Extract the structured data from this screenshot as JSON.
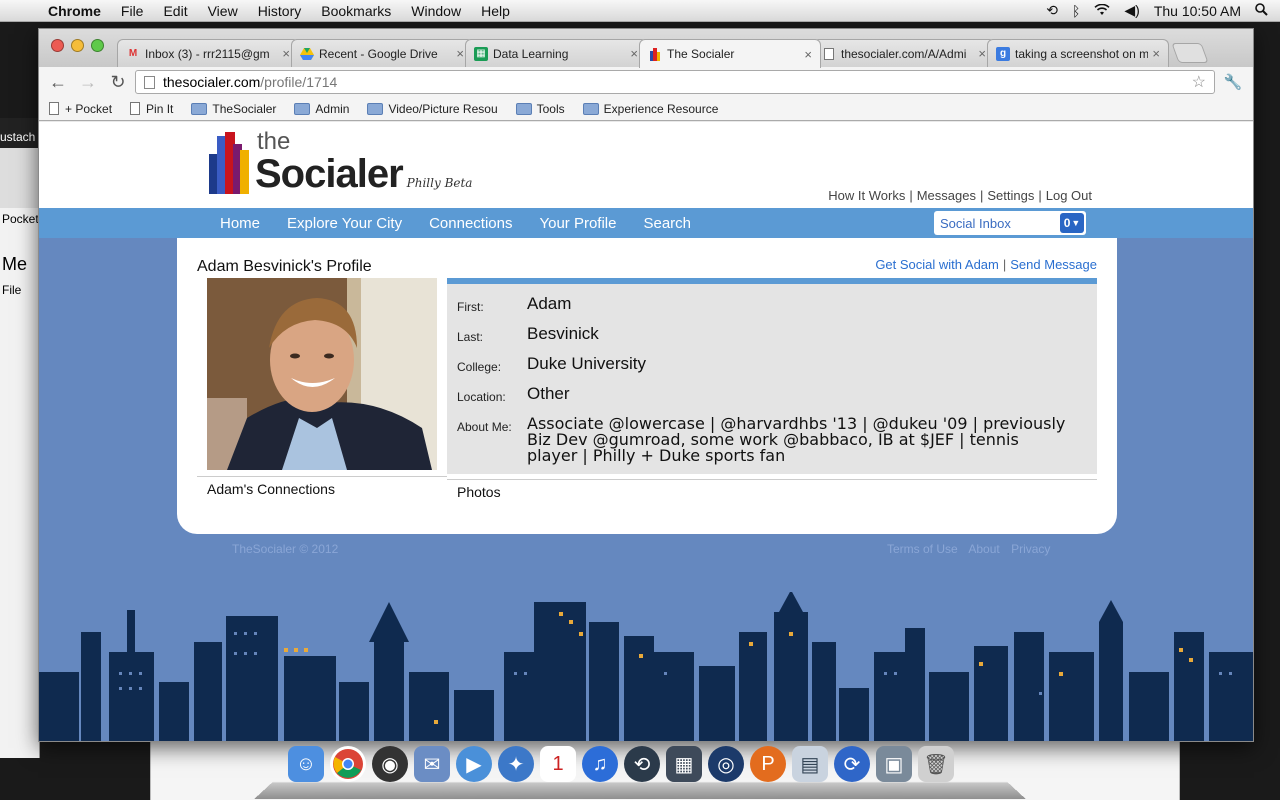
{
  "menubar": {
    "app": "Chrome",
    "menus": [
      "File",
      "Edit",
      "View",
      "History",
      "Bookmarks",
      "Window",
      "Help"
    ],
    "clock": "Thu 10:50 AM"
  },
  "background_window": {
    "title_fragment": "ustach",
    "pocket": "Pocket",
    "heading_fragment": "Me",
    "file": "File"
  },
  "tabs": [
    {
      "title": "Inbox (3) - rrr2115@gm",
      "favicon": "gmail-icon"
    },
    {
      "title": "Recent - Google Drive",
      "favicon": "drive-icon"
    },
    {
      "title": "Data Learning",
      "favicon": "sheets-icon"
    },
    {
      "title": "The Socialer",
      "favicon": "socialer-icon",
      "active": true
    },
    {
      "title": "thesocialer.com/A/Admi",
      "favicon": "page-icon"
    },
    {
      "title": "taking a screenshot on m",
      "favicon": "google-icon"
    }
  ],
  "omnibox": {
    "host": "thesocialer.com",
    "path": "/profile/1714"
  },
  "bookmarks": [
    {
      "label": "+ Pocket",
      "kind": "page"
    },
    {
      "label": "Pin It",
      "kind": "page"
    },
    {
      "label": "TheSocialer",
      "kind": "folder"
    },
    {
      "label": "Admin",
      "kind": "folder"
    },
    {
      "label": "Video/Picture Resou",
      "kind": "folder"
    },
    {
      "label": "Tools",
      "kind": "folder"
    },
    {
      "label": "Experience Resource",
      "kind": "folder"
    }
  ],
  "site": {
    "logo_the": "the",
    "logo_socialer": "Socialer",
    "logo_beta": "Philly Beta",
    "toplinks": [
      "How It Works",
      "Messages",
      "Settings",
      "Log Out"
    ],
    "nav": [
      "Home",
      "Explore Your City",
      "Connections",
      "Your Profile",
      "Search"
    ],
    "inbox_label": "Social Inbox",
    "inbox_count": "0"
  },
  "profile": {
    "title": "Adam Besvinick's Profile",
    "action_social": "Get Social with Adam",
    "action_message": "Send Message",
    "fields": [
      {
        "label": "First:",
        "value": "Adam"
      },
      {
        "label": "Last:",
        "value": "Besvinick"
      },
      {
        "label": "College:",
        "value": "Duke University"
      },
      {
        "label": "Location:",
        "value": "Other"
      }
    ],
    "about_label": "About Me:",
    "about_value": "Associate @lowercase | @harvardhbs '13 | @dukeu '09 | previously Biz Dev @gumroad, some work @babbaco, IB at $JEF | tennis player | Philly + Duke sports fan",
    "connections_label": "Adam's Connections",
    "photos_label": "Photos"
  },
  "footer": {
    "copyright": "TheSocialer © 2012",
    "links": [
      "Terms of Use",
      "About",
      "Privacy"
    ]
  },
  "colors": {
    "nav_blue": "#5b9ad4",
    "page_bg": "#6588bf",
    "link_blue": "#2a6fd0",
    "skyline": "#0f2a4f"
  }
}
